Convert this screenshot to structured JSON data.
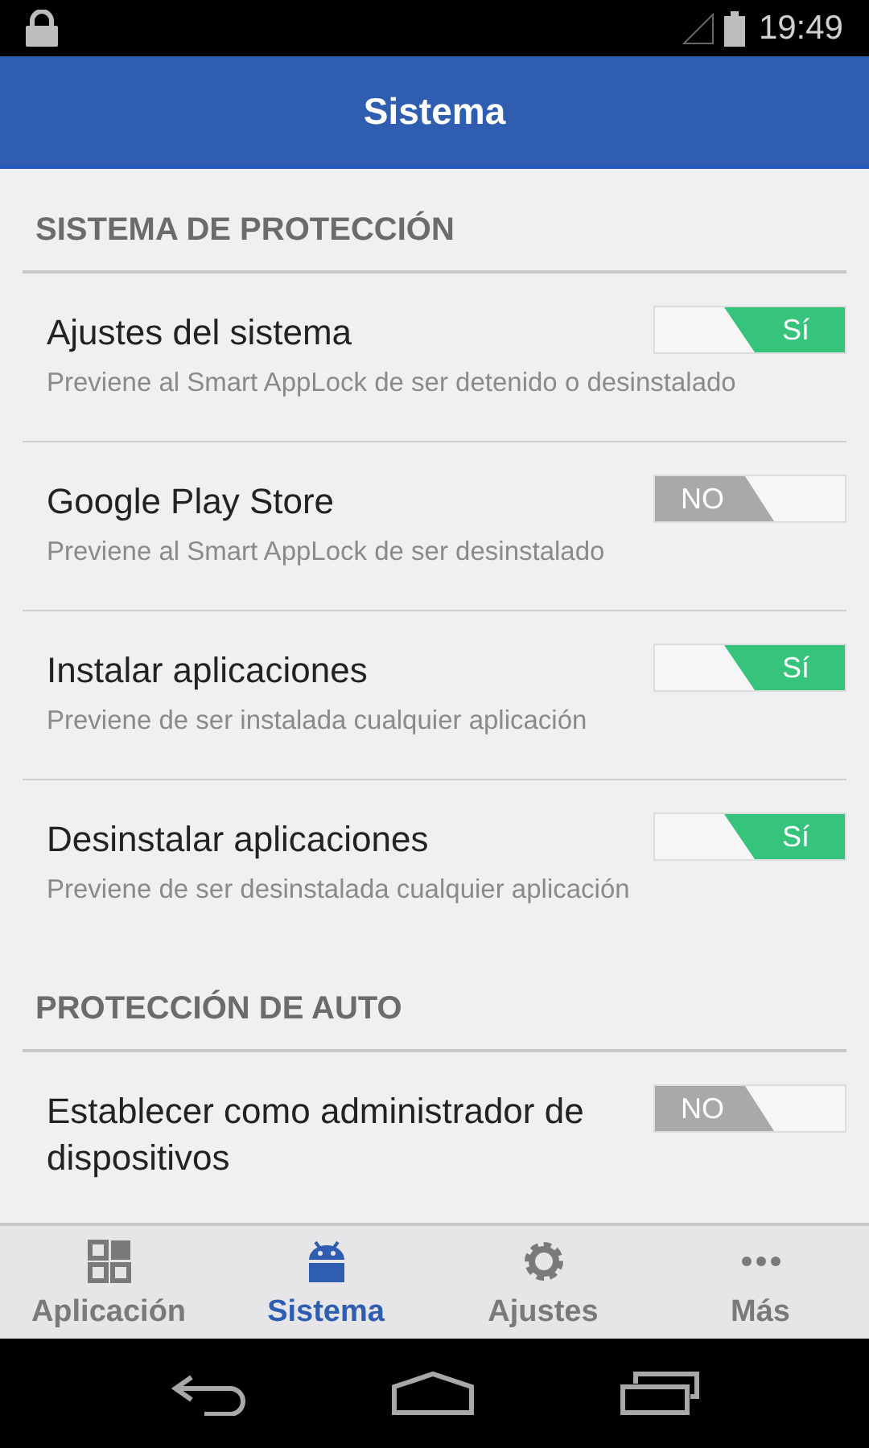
{
  "status_bar": {
    "time": "19:49"
  },
  "header": {
    "title": "Sistema"
  },
  "sections": [
    {
      "title": "SISTEMA DE PROTECCIÓN",
      "items": [
        {
          "title": "Ajustes del sistema",
          "description": "Previene al Smart AppLock de ser detenido o desinstalado",
          "toggle": {
            "on": true,
            "label": "Sí"
          }
        },
        {
          "title": "Google Play Store",
          "description": "Previene al Smart AppLock de ser desinstalado",
          "toggle": {
            "on": false,
            "label": "NO"
          }
        },
        {
          "title": "Instalar aplicaciones",
          "description": "Previene de ser instalada cualquier aplicación",
          "toggle": {
            "on": true,
            "label": "Sí"
          }
        },
        {
          "title": "Desinstalar aplicaciones",
          "description": "Previene de ser desinstalada cualquier aplicación",
          "toggle": {
            "on": true,
            "label": "Sí"
          }
        }
      ]
    },
    {
      "title": "PROTECCIÓN DE AUTO",
      "items": [
        {
          "title": "Establecer como administrador de dispositivos",
          "toggle": {
            "on": false,
            "label": "NO"
          }
        }
      ]
    }
  ],
  "tabs": [
    {
      "label": "Aplicación",
      "kind": "grid",
      "selected": false
    },
    {
      "label": "Sistema",
      "kind": "android",
      "selected": true
    },
    {
      "label": "Ajustes",
      "kind": "gear",
      "selected": false
    },
    {
      "label": "Más",
      "kind": "dots",
      "selected": false
    }
  ]
}
